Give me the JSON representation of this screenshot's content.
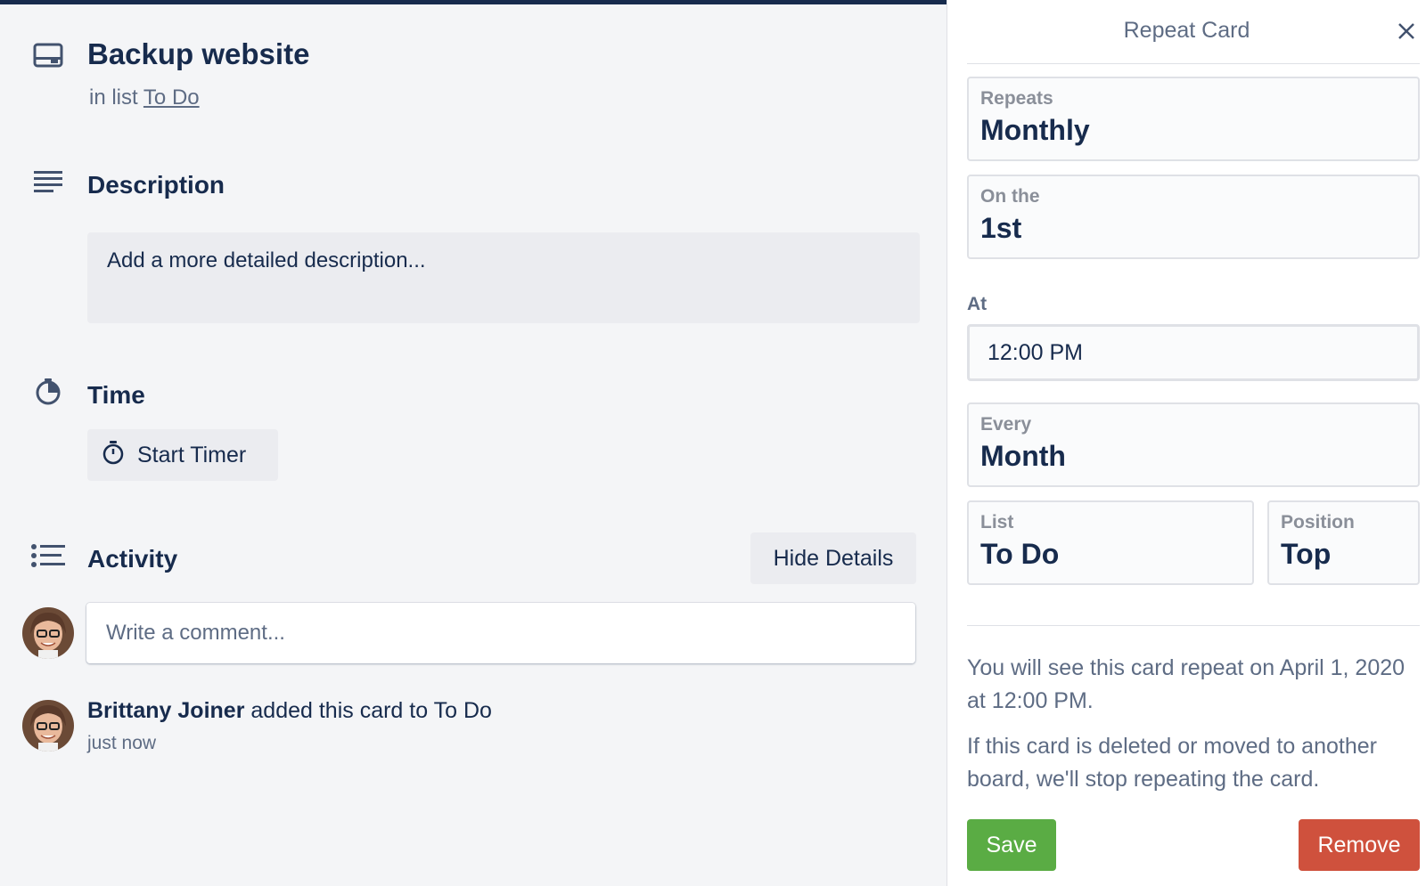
{
  "card": {
    "title": "Backup website",
    "in_list_prefix": "in list",
    "list_name": "To Do"
  },
  "description": {
    "heading": "Description",
    "placeholder": "Add a more detailed description..."
  },
  "time": {
    "heading": "Time",
    "start_timer_label": "Start Timer"
  },
  "activity": {
    "heading": "Activity",
    "hide_details_label": "Hide Details",
    "comment_placeholder": "Write a comment...",
    "entries": [
      {
        "user": "Brittany Joiner",
        "action": " added this card to To Do",
        "time": "just now"
      }
    ]
  },
  "repeat_popover": {
    "title": "Repeat Card",
    "repeats": {
      "label": "Repeats",
      "value": "Monthly"
    },
    "on_the": {
      "label": "On the",
      "value": "1st"
    },
    "at": {
      "label": "At",
      "value": "12:00 PM"
    },
    "every": {
      "label": "Every",
      "value": "Month"
    },
    "list": {
      "label": "List",
      "value": "To Do"
    },
    "position": {
      "label": "Position",
      "value": "Top"
    },
    "info_next": "You will see this card repeat on April 1, 2020 at 12:00 PM.",
    "info_warning": "If this card is deleted or moved to another board, we'll stop repeating the card.",
    "save_label": "Save",
    "remove_label": "Remove"
  },
  "icons": {
    "card": "card-icon",
    "description": "description-icon",
    "time": "clock-icon",
    "timer": "stopwatch-icon",
    "activity": "activity-icon",
    "close": "close-icon"
  },
  "colors": {
    "save": "#5aac44",
    "remove": "#cf513d",
    "text_primary": "#172b4d",
    "text_subtle": "#5e6c84",
    "pane_background": "#f4f5f7"
  }
}
